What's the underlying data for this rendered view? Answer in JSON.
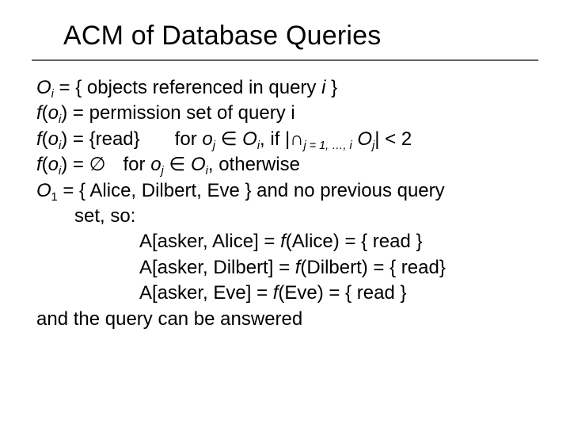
{
  "title": "ACM of Database Queries",
  "t": {
    "O": "O",
    "f": "f",
    "o": "o",
    "i": "i",
    "j": "j",
    "one": "1",
    "eq": " = ",
    "lbrace": "{ ",
    "rbrace": " }",
    "objects_ref": "objects referenced in query ",
    "perm_set": "permission set of query i",
    "read_set": "{read}",
    "for": "for ",
    "elem": " ∈ ",
    "comma_if": ", if |",
    "cap": "∩",
    "subexpr": "j = 1, …, i",
    "tail_lt2": "| < 2",
    "emptyset": "∅",
    "otherwise": ", otherwise",
    "alice_dilbert_eve": "{ Alice, Dilbert, Eve } and no previous query",
    "set_so": "set, so:",
    "a1": "A[asker, Alice] = ",
    "a1b": "(Alice) = { read }",
    "a2": "A[asker, Dilbert] = ",
    "a2b": "(Dilbert) = { read}",
    "a3": "A[asker, Eve] = ",
    "a3b": "(Eve) = { read }",
    "conclusion": "and the query can be answered"
  }
}
